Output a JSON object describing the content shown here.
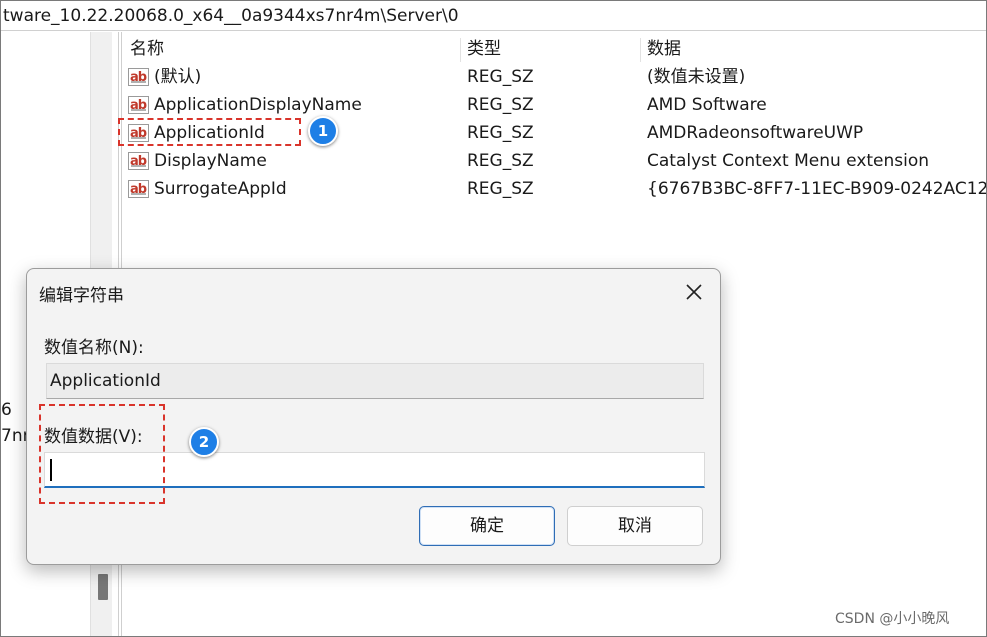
{
  "address_bar": {
    "path": "tware_10.22.20068.0_x64__0a9344xs7nr4m\\Server\\0"
  },
  "tree": {
    "fragments": [
      "6",
      "7nr"
    ]
  },
  "list": {
    "columns": {
      "name": "名称",
      "type": "类型",
      "data": "数据"
    },
    "rows": [
      {
        "name": "(默认)",
        "type": "REG_SZ",
        "data": "(数值未设置)"
      },
      {
        "name": "ApplicationDisplayName",
        "type": "REG_SZ",
        "data": "AMD Software"
      },
      {
        "name": "ApplicationId",
        "type": "REG_SZ",
        "data": "AMDRadeonsoftwareUWP"
      },
      {
        "name": "DisplayName",
        "type": "REG_SZ",
        "data": "Catalyst Context Menu extension"
      },
      {
        "name": "SurrogateAppId",
        "type": "REG_SZ",
        "data": "{6767B3BC-8FF7-11EC-B909-0242AC12"
      }
    ],
    "icon": "ab-string-value-icon"
  },
  "annotations": {
    "badge1": "1",
    "badge2": "2",
    "highlight_color": "#d9342b",
    "badge_color": "#1e7fe6"
  },
  "dialog": {
    "title": "编辑字符串",
    "name_label": "数值名称(N):",
    "name_value": "ApplicationId",
    "data_label": "数值数据(V):",
    "data_value": "",
    "ok": "确定",
    "cancel": "取消",
    "accent": "#1f6fbd"
  },
  "watermark": "CSDN @小小晚风"
}
